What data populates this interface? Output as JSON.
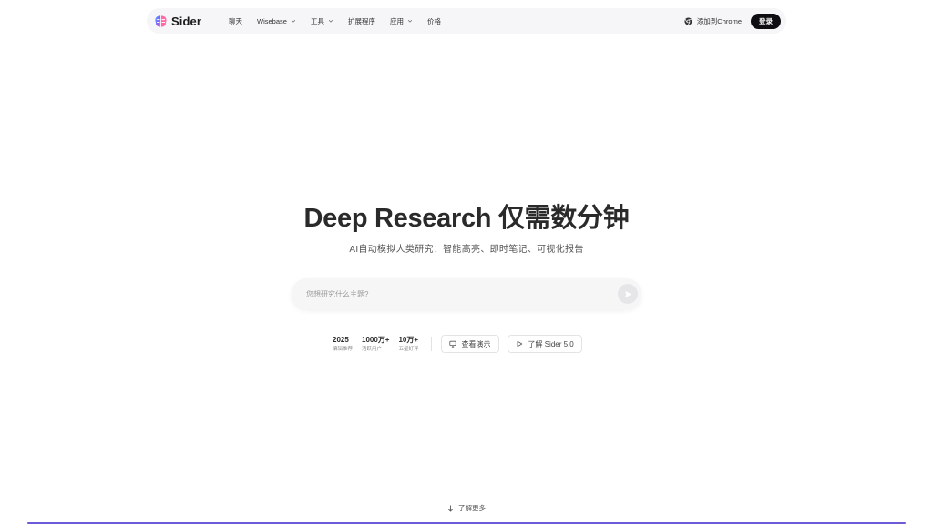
{
  "brand": {
    "name": "Sider",
    "logo_icon": "brain-icon",
    "logo_colors": [
      "#7b61ff",
      "#ff6ba8",
      "#4fa8ff"
    ]
  },
  "nav": {
    "items": [
      {
        "label": "聊天",
        "has_dropdown": false
      },
      {
        "label": "Wisebase",
        "has_dropdown": true
      },
      {
        "label": "工具",
        "has_dropdown": true
      },
      {
        "label": "扩展程序",
        "has_dropdown": false
      },
      {
        "label": "应用",
        "has_dropdown": true
      },
      {
        "label": "价格",
        "has_dropdown": false
      }
    ],
    "chrome_label": "添加到Chrome",
    "login_label": "登录"
  },
  "hero": {
    "title": "Deep Research 仅需数分钟",
    "subtitle": "AI自动模拟人类研究：智能高亮、即时笔记、可视化报告"
  },
  "search": {
    "placeholder": "您想研究什么主题?",
    "value": ""
  },
  "stats": [
    {
      "value": "2025",
      "label": "编辑推荐"
    },
    {
      "value": "1000万+",
      "label": "活跃用户"
    },
    {
      "value": "10万+",
      "label": "五星好评"
    }
  ],
  "actions": {
    "demo_label": "查看演示",
    "demo_icon": "monitor-icon",
    "learn_label": "了解 Sider 5.0",
    "learn_icon": "play-icon"
  },
  "footer": {
    "learn_more_label": "了解更多",
    "accent_color": "#6b5bd6"
  }
}
